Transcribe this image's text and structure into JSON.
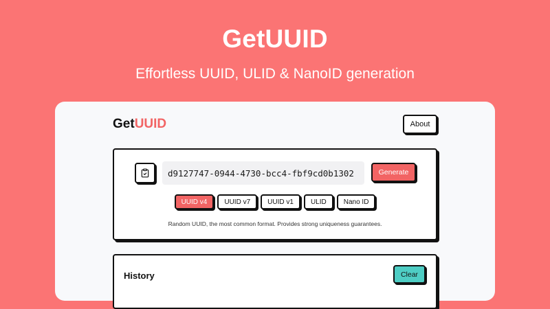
{
  "hero": {
    "title": "GetUUID",
    "subtitle": "Effortless UUID, ULID & NanoID generation"
  },
  "app": {
    "brand_prefix": "Get",
    "brand_accent": "UUID",
    "about_label": "About"
  },
  "generator": {
    "copy_icon": "clipboard-icon",
    "value": "d9127747-0944-4730-bcc4-fbf9cd0b1302",
    "generate_label": "Generate",
    "formats": [
      {
        "label": "UUID v4",
        "active": true
      },
      {
        "label": "UUID v7",
        "active": false
      },
      {
        "label": "UUID v1",
        "active": false
      },
      {
        "label": "ULID",
        "active": false
      },
      {
        "label": "Nano ID",
        "active": false
      }
    ],
    "description": "Random UUID, the most common format. Provides strong uniqueness guarantees."
  },
  "history": {
    "title": "History",
    "clear_label": "Clear"
  },
  "colors": {
    "background": "#fb7474",
    "accent": "#f26464",
    "clear": "#4ecdc4"
  }
}
